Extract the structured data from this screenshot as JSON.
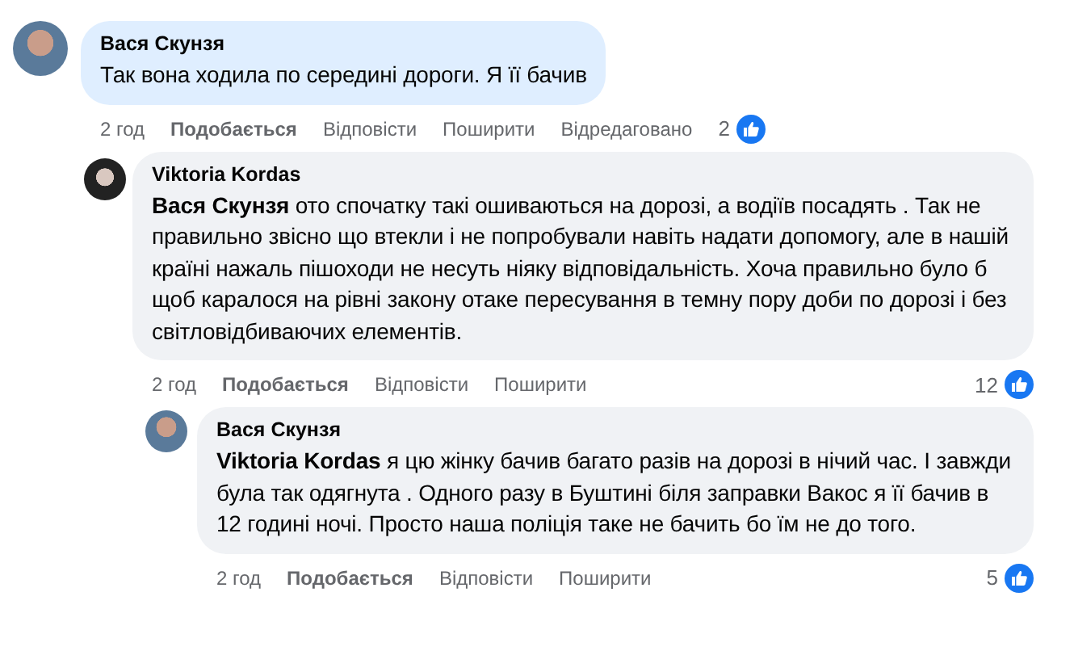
{
  "comments": [
    {
      "author": "Вася Скунзя",
      "text": "Так вона ходила по середині дороги. Я її бачив",
      "highlighted": true,
      "time": "2 год",
      "actions": [
        "Подобається",
        "Відповісти",
        "Поширити"
      ],
      "edited": "Відредаговано",
      "reactions": "2",
      "children": [
        {
          "author": "Viktoria Kordas",
          "text": "**Вася Скунзя** ото спочатку такі ошиваються на дорозі, а водіїв посадять . Так не правильно звісно що втекли і не попробували навіть надати допомогу, але в нашій країні нажаль пішоходи не несуть ніяку відповідальність. Хоча правильно було б щоб каралося на рівні закону отаке пересування в темну пору доби по дорозі і без світловідбиваючих елементів.",
          "highlighted": false,
          "time": "2 год",
          "actions": [
            "Подобається",
            "Відповісти",
            "Поширити"
          ],
          "reactions": "12",
          "children": [
            {
              "author": "Вася Скунзя",
              "text": "**Viktoria Kordas** я цю жінку бачив багато разів на дорозі в нічий час. І завжди була так одягнута . Одного разу в Буштині біля заправки Вакос я її бачив в 12 годині ночі. Просто наша поліція таке не бачить бо їм не до того.",
              "highlighted": false,
              "time": "2 год",
              "actions": [
                "Подобається",
                "Відповісти",
                "Поширити"
              ],
              "reactions": "5"
            }
          ]
        }
      ]
    }
  ]
}
